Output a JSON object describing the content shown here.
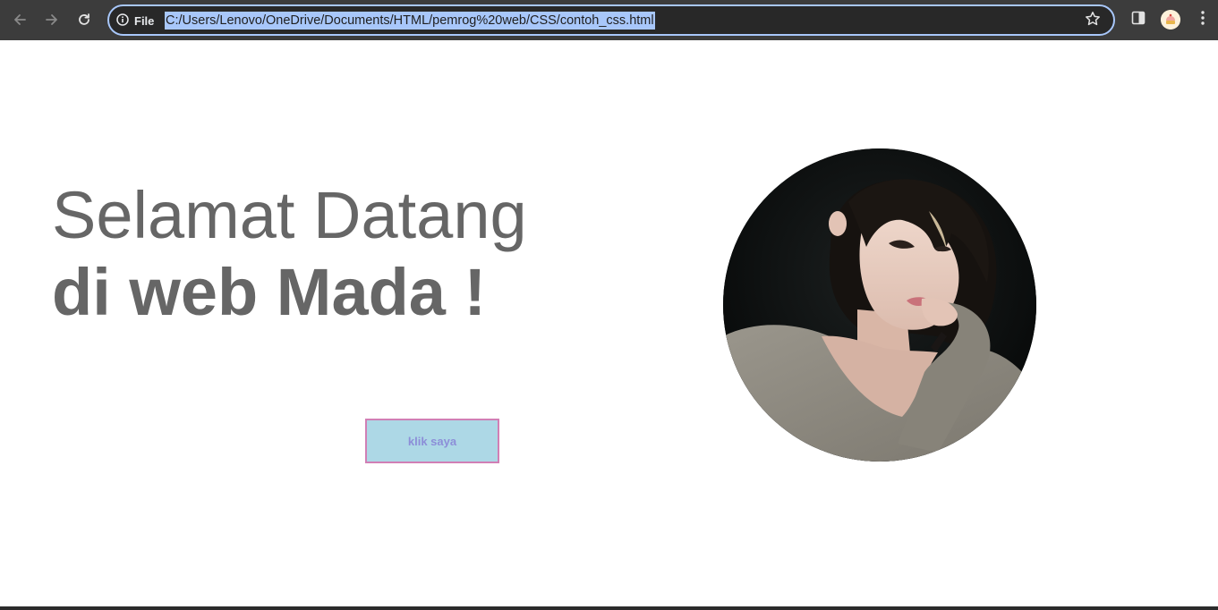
{
  "browser": {
    "site_info_label": "File",
    "url": "C:/Users/Lenovo/OneDrive/Documents/HTML/pemrog%20web/CSS/contoh_css.html",
    "icons": {
      "back": "arrow-left",
      "forward": "arrow-right",
      "reload": "reload",
      "site_info": "info-circle",
      "bookmark": "star-outline",
      "side_panel": "side-panel",
      "profile": "avatar",
      "menu": "vertical-dots"
    },
    "colors": {
      "toolbar_bg": "#3c3c3c",
      "omnibox_border": "#a8c7fa",
      "url_selection": "#a8c7fa"
    }
  },
  "page": {
    "headline_line1": "Selamat Datang",
    "headline_line2": "di web Mada !",
    "button_label": "klik saya",
    "photo_description": "",
    "colors": {
      "headline": "#666666",
      "button_bg": "#add8e6",
      "button_border": "#d17fb5",
      "button_text": "#8c8ed8"
    }
  }
}
